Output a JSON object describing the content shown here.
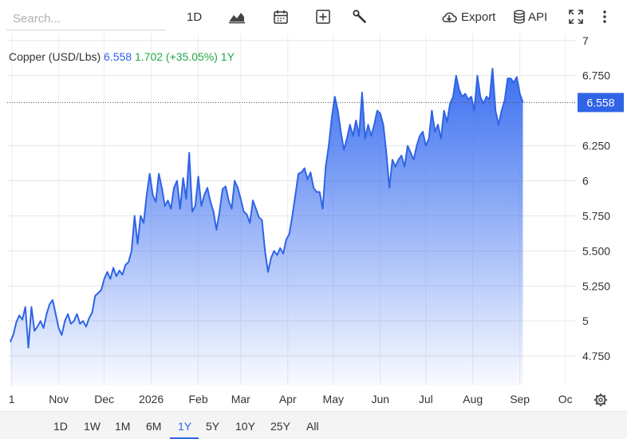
{
  "toolbar": {
    "search_placeholder": "Search...",
    "interval_label": "1D",
    "export_label": "Export",
    "api_label": "API",
    "icons": [
      "chart-type-icon",
      "calendar-icon",
      "add-indicator-icon",
      "wrench-icon",
      "cloud-download-icon",
      "database-icon",
      "fullscreen-icon",
      "more-vertical-icon"
    ]
  },
  "legend": {
    "name": "Copper (USD/Lbs)",
    "price": "6.558",
    "change": "1.702 (+35.05%)",
    "period": "1Y"
  },
  "range": {
    "options": [
      "1D",
      "1W",
      "1M",
      "6M",
      "1Y",
      "5Y",
      "10Y",
      "25Y",
      "All"
    ],
    "active": "1Y"
  },
  "colors": {
    "line": "#2f64e6",
    "area_top": "#3b6ff0",
    "positive": "#22a845"
  },
  "chart_data": {
    "type": "area",
    "title": "Copper (USD/Lbs)",
    "last_value": 6.558,
    "x_ticks": [
      {
        "label": "1",
        "x": "2025-10-01"
      },
      {
        "label": "Nov",
        "x": "2025-11-01"
      },
      {
        "label": "Dec",
        "x": "2025-12-01"
      },
      {
        "label": "2026",
        "x": "2026-01-01"
      },
      {
        "label": "Feb",
        "x": "2026-02-01"
      },
      {
        "label": "Mar",
        "x": "2026-03-01"
      },
      {
        "label": "Apr",
        "x": "2026-04-01"
      },
      {
        "label": "May",
        "x": "2026-05-01"
      },
      {
        "label": "Jun",
        "x": "2026-06-01"
      },
      {
        "label": "Jul",
        "x": "2026-07-01"
      },
      {
        "label": "Aug",
        "x": "2026-08-01"
      },
      {
        "label": "Sep",
        "x": "2026-09-01"
      },
      {
        "label": "Oc",
        "x": "2026-10-01"
      }
    ],
    "y_ticks": [
      {
        "label": "4.750",
        "value": 4.75
      },
      {
        "label": "5",
        "value": 5.0
      },
      {
        "label": "5.250",
        "value": 5.25
      },
      {
        "label": "5.500",
        "value": 5.5
      },
      {
        "label": "5.750",
        "value": 5.75
      },
      {
        "label": "6",
        "value": 6.0
      },
      {
        "label": "6.250",
        "value": 6.25
      },
      {
        "label": "6.750",
        "value": 6.75
      },
      {
        "label": "7",
        "value": 7.0
      }
    ],
    "ylim": [
      4.54,
      7.05
    ],
    "series": [
      {
        "values": [
          [
            "2025-09-30",
            4.85
          ],
          [
            "2025-10-02",
            4.9
          ],
          [
            "2025-10-04",
            4.99
          ],
          [
            "2025-10-06",
            5.04
          ],
          [
            "2025-10-08",
            5.01
          ],
          [
            "2025-10-10",
            5.1
          ],
          [
            "2025-10-12",
            4.81
          ],
          [
            "2025-10-14",
            5.1
          ],
          [
            "2025-10-16",
            4.93
          ],
          [
            "2025-10-18",
            4.96
          ],
          [
            "2025-10-20",
            5.0
          ],
          [
            "2025-10-22",
            4.95
          ],
          [
            "2025-10-24",
            5.05
          ],
          [
            "2025-10-26",
            5.12
          ],
          [
            "2025-10-28",
            5.15
          ],
          [
            "2025-10-30",
            5.05
          ],
          [
            "2025-11-01",
            4.95
          ],
          [
            "2025-11-03",
            4.9
          ],
          [
            "2025-11-05",
            5.0
          ],
          [
            "2025-11-07",
            5.05
          ],
          [
            "2025-11-09",
            4.98
          ],
          [
            "2025-11-11",
            5.0
          ],
          [
            "2025-11-13",
            5.05
          ],
          [
            "2025-11-15",
            4.98
          ],
          [
            "2025-11-17",
            5.0
          ],
          [
            "2025-11-19",
            4.96
          ],
          [
            "2025-11-21",
            5.02
          ],
          [
            "2025-11-23",
            5.06
          ],
          [
            "2025-11-25",
            5.18
          ],
          [
            "2025-11-27",
            5.2
          ],
          [
            "2025-11-29",
            5.22
          ],
          [
            "2025-12-01",
            5.3
          ],
          [
            "2025-12-03",
            5.35
          ],
          [
            "2025-12-05",
            5.3
          ],
          [
            "2025-12-07",
            5.38
          ],
          [
            "2025-12-09",
            5.32
          ],
          [
            "2025-12-11",
            5.36
          ],
          [
            "2025-12-13",
            5.33
          ],
          [
            "2025-12-15",
            5.4
          ],
          [
            "2025-12-17",
            5.42
          ],
          [
            "2025-12-19",
            5.5
          ],
          [
            "2025-12-21",
            5.75
          ],
          [
            "2025-12-23",
            5.55
          ],
          [
            "2025-12-25",
            5.75
          ],
          [
            "2025-12-27",
            5.7
          ],
          [
            "2025-12-29",
            5.9
          ],
          [
            "2025-12-31",
            6.05
          ],
          [
            "2026-01-02",
            5.9
          ],
          [
            "2026-01-04",
            5.85
          ],
          [
            "2026-01-06",
            6.05
          ],
          [
            "2026-01-08",
            5.95
          ],
          [
            "2026-01-10",
            5.82
          ],
          [
            "2026-01-12",
            5.86
          ],
          [
            "2026-01-14",
            5.8
          ],
          [
            "2026-01-16",
            5.95
          ],
          [
            "2026-01-18",
            6.0
          ],
          [
            "2026-01-20",
            5.8
          ],
          [
            "2026-01-22",
            6.02
          ],
          [
            "2026-01-24",
            5.87
          ],
          [
            "2026-01-26",
            6.2
          ],
          [
            "2026-01-28",
            5.78
          ],
          [
            "2026-01-30",
            5.82
          ],
          [
            "2026-02-01",
            6.03
          ],
          [
            "2026-02-03",
            5.82
          ],
          [
            "2026-02-05",
            5.9
          ],
          [
            "2026-02-07",
            5.95
          ],
          [
            "2026-02-09",
            5.85
          ],
          [
            "2026-02-11",
            5.78
          ],
          [
            "2026-02-13",
            5.65
          ],
          [
            "2026-02-15",
            5.78
          ],
          [
            "2026-02-17",
            5.94
          ],
          [
            "2026-02-19",
            5.96
          ],
          [
            "2026-02-21",
            5.86
          ],
          [
            "2026-02-23",
            5.8
          ],
          [
            "2026-02-25",
            6.0
          ],
          [
            "2026-02-27",
            5.95
          ],
          [
            "2026-03-01",
            5.87
          ],
          [
            "2026-03-03",
            5.78
          ],
          [
            "2026-03-05",
            5.76
          ],
          [
            "2026-03-07",
            5.7
          ],
          [
            "2026-03-09",
            5.86
          ],
          [
            "2026-03-11",
            5.8
          ],
          [
            "2026-03-13",
            5.74
          ],
          [
            "2026-03-15",
            5.72
          ],
          [
            "2026-03-17",
            5.5
          ],
          [
            "2026-03-19",
            5.35
          ],
          [
            "2026-03-21",
            5.45
          ],
          [
            "2026-03-23",
            5.5
          ],
          [
            "2026-03-25",
            5.47
          ],
          [
            "2026-03-27",
            5.52
          ],
          [
            "2026-03-29",
            5.48
          ],
          [
            "2026-03-31",
            5.58
          ],
          [
            "2026-04-02",
            5.62
          ],
          [
            "2026-04-04",
            5.75
          ],
          [
            "2026-04-06",
            5.9
          ],
          [
            "2026-04-08",
            6.05
          ],
          [
            "2026-04-10",
            6.06
          ],
          [
            "2026-04-12",
            6.09
          ],
          [
            "2026-04-14",
            6.01
          ],
          [
            "2026-04-16",
            6.06
          ],
          [
            "2026-04-18",
            5.95
          ],
          [
            "2026-04-20",
            5.92
          ],
          [
            "2026-04-22",
            5.92
          ],
          [
            "2026-04-24",
            5.8
          ],
          [
            "2026-04-26",
            6.1
          ],
          [
            "2026-04-28",
            6.25
          ],
          [
            "2026-04-30",
            6.45
          ],
          [
            "2026-05-02",
            6.6
          ],
          [
            "2026-05-04",
            6.5
          ],
          [
            "2026-05-06",
            6.35
          ],
          [
            "2026-05-08",
            6.22
          ],
          [
            "2026-05-10",
            6.3
          ],
          [
            "2026-05-12",
            6.4
          ],
          [
            "2026-05-14",
            6.32
          ],
          [
            "2026-05-16",
            6.43
          ],
          [
            "2026-05-18",
            6.32
          ],
          [
            "2026-05-20",
            6.63
          ],
          [
            "2026-05-22",
            6.3
          ],
          [
            "2026-05-24",
            6.4
          ],
          [
            "2026-05-26",
            6.32
          ],
          [
            "2026-05-28",
            6.4
          ],
          [
            "2026-05-30",
            6.5
          ],
          [
            "2026-06-01",
            6.48
          ],
          [
            "2026-06-03",
            6.4
          ],
          [
            "2026-06-05",
            6.2
          ],
          [
            "2026-06-07",
            5.95
          ],
          [
            "2026-06-09",
            6.15
          ],
          [
            "2026-06-11",
            6.1
          ],
          [
            "2026-06-13",
            6.15
          ],
          [
            "2026-06-15",
            6.18
          ],
          [
            "2026-06-17",
            6.1
          ],
          [
            "2026-06-19",
            6.25
          ],
          [
            "2026-06-21",
            6.2
          ],
          [
            "2026-06-23",
            6.15
          ],
          [
            "2026-06-25",
            6.25
          ],
          [
            "2026-06-27",
            6.32
          ],
          [
            "2026-06-29",
            6.35
          ],
          [
            "2026-07-01",
            6.25
          ],
          [
            "2026-07-03",
            6.3
          ],
          [
            "2026-07-05",
            6.5
          ],
          [
            "2026-07-07",
            6.35
          ],
          [
            "2026-07-09",
            6.4
          ],
          [
            "2026-07-11",
            6.3
          ],
          [
            "2026-07-13",
            6.5
          ],
          [
            "2026-07-15",
            6.42
          ],
          [
            "2026-07-17",
            6.55
          ],
          [
            "2026-07-19",
            6.6
          ],
          [
            "2026-07-21",
            6.75
          ],
          [
            "2026-07-23",
            6.65
          ],
          [
            "2026-07-25",
            6.6
          ],
          [
            "2026-07-27",
            6.62
          ],
          [
            "2026-07-29",
            6.58
          ],
          [
            "2026-07-31",
            6.6
          ],
          [
            "2026-08-02",
            6.5
          ],
          [
            "2026-08-04",
            6.75
          ],
          [
            "2026-08-06",
            6.6
          ],
          [
            "2026-08-08",
            6.55
          ],
          [
            "2026-08-10",
            6.6
          ],
          [
            "2026-08-12",
            6.58
          ],
          [
            "2026-08-14",
            6.8
          ],
          [
            "2026-08-16",
            6.5
          ],
          [
            "2026-08-18",
            6.4
          ],
          [
            "2026-08-20",
            6.5
          ],
          [
            "2026-08-22",
            6.57
          ],
          [
            "2026-08-24",
            6.73
          ],
          [
            "2026-08-26",
            6.73
          ],
          [
            "2026-08-28",
            6.7
          ],
          [
            "2026-08-30",
            6.74
          ],
          [
            "2026-09-01",
            6.62
          ],
          [
            "2026-09-03",
            6.558
          ]
        ]
      }
    ]
  }
}
